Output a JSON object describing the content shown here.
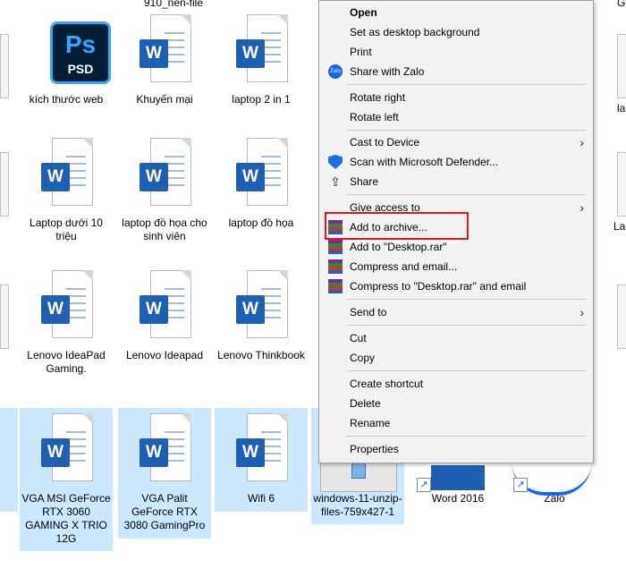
{
  "desktop": {
    "items": [
      {
        "label": "910_nen-file"
      },
      {
        "label": "kích thước web",
        "icon_label_big": "Ps",
        "icon_label_small": "PSD"
      },
      {
        "label": "Khuyến mại"
      },
      {
        "label": "laptop 2 in 1"
      },
      {
        "label": "Laptop dưới 10 triệu"
      },
      {
        "label": "laptop đồ họa cho sinh viên"
      },
      {
        "label": "laptop đồ họa"
      },
      {
        "label": "Lenovo IdeaPad Gaming."
      },
      {
        "label": "Lenovo Ideapad"
      },
      {
        "label": "Lenovo Thinkbook"
      },
      {
        "label": "VGA MSI GeForce RTX 3060 GAMING X TRIO 12G"
      },
      {
        "label": "VGA Palit GeForce RTX 3080 GamingPro"
      },
      {
        "label": "Wifi 6"
      },
      {
        "label": "windows-11-unzip-files-759x427-1"
      },
      {
        "label": "Word 2016"
      },
      {
        "label": "Zalo"
      }
    ],
    "edge_labels": {
      "right_top": "G",
      "right_row1": "la",
      "right_row2": "La"
    },
    "word_badge": "W"
  },
  "context_menu": {
    "items": [
      {
        "label": "Open"
      },
      {
        "label": "Set as desktop background"
      },
      {
        "label": "Print"
      },
      {
        "label": "Share with Zalo",
        "icon": "zalo-icon"
      },
      {
        "label": "Rotate right"
      },
      {
        "label": "Rotate left"
      },
      {
        "label": "Cast to Device"
      },
      {
        "label": "Scan with Microsoft Defender...",
        "icon": "defender-icon"
      },
      {
        "label": "Share",
        "icon": "share-icon"
      },
      {
        "label": "Give access to"
      },
      {
        "label": "Add to archive...",
        "icon": "winrar-icon"
      },
      {
        "label": "Add to \"Desktop.rar\"",
        "icon": "winrar-icon"
      },
      {
        "label": "Compress and email...",
        "icon": "winrar-icon"
      },
      {
        "label": "Compress to \"Desktop.rar\" and email",
        "icon": "winrar-icon"
      },
      {
        "label": "Send to"
      },
      {
        "label": "Cut"
      },
      {
        "label": "Copy"
      },
      {
        "label": "Create shortcut"
      },
      {
        "label": "Delete"
      },
      {
        "label": "Rename"
      },
      {
        "label": "Properties"
      }
    ],
    "zalo_icon_text": "Zalo"
  },
  "colors": {
    "selection": "#cce8ff",
    "highlight_border": "#e0161a",
    "word_blue": "#1d5fb3",
    "menu_bg": "#f2f2f2"
  }
}
